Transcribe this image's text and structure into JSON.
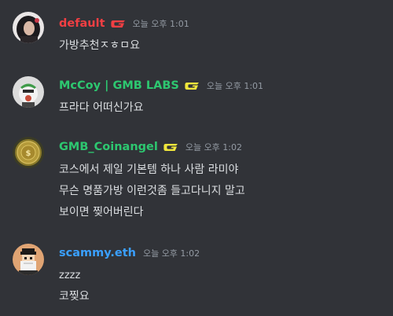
{
  "messages": [
    {
      "username": "default",
      "name_color": "#f23f43",
      "badge_color": "#f23f43",
      "time": "오늘 오후 1:01",
      "lines": [
        "가방추천ㅈㅎㅁ요"
      ],
      "avatar_icon": "user-avatar"
    },
    {
      "username": "McCoy | GMB LABS",
      "name_color": "#2dc770",
      "badge_color": "#f0e63c",
      "time": "오늘 오후 1:01",
      "lines": [
        "프라다 어떠신가요"
      ],
      "avatar_icon": "user-avatar"
    },
    {
      "username": "GMB_Coinangel",
      "name_color": "#2dc770",
      "badge_color": "#f0e63c",
      "time": "오늘 오후 1:02",
      "lines": [
        "코스에서 제일 기본템 하나 사람 라미야",
        "무슨 명품가방 이런것좀 들고다니지 말고",
        "보이면 찢어버린다"
      ],
      "avatar_icon": "coin-avatar"
    },
    {
      "username": "scammy.eth",
      "name_color": "#3aa0ff",
      "time": "오늘 오후 1:02",
      "lines": [
        "zzzz",
        "코찢요"
      ],
      "avatar_icon": "pixel-avatar"
    }
  ]
}
